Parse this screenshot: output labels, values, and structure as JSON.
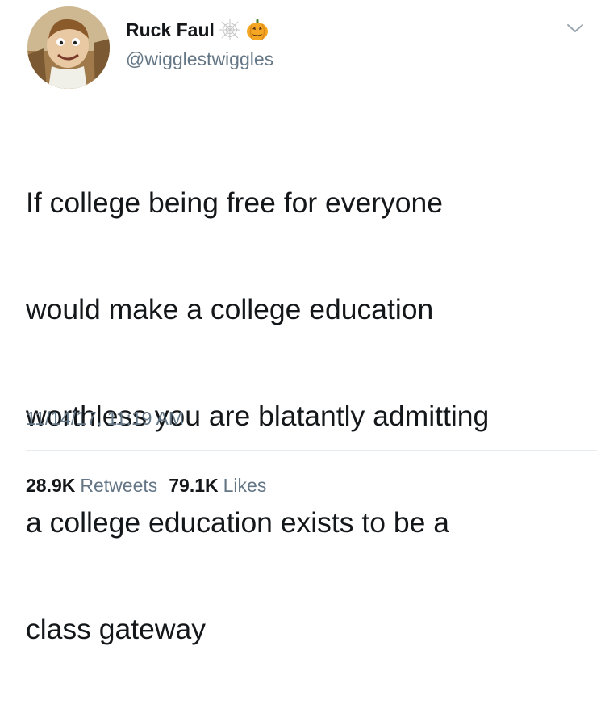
{
  "tweet": {
    "display_name": "Ruck Faul",
    "handle": "@wigglestwiggles",
    "name_emojis": [
      "spiderweb-icon",
      "jack-o-lantern-icon"
    ],
    "text_lines": [
      "If college being free for everyone",
      "would make a college education",
      "worthless you are blatantly admitting",
      "a college education exists to be a",
      "class gateway"
    ],
    "timestamp": "11/14/17, 11:19 AM",
    "retweets_count": "28.9K",
    "retweets_label": "Retweets",
    "likes_count": "79.1K",
    "likes_label": "Likes"
  },
  "colors": {
    "text_primary": "#14171a",
    "text_secondary": "#657786",
    "divider": "#e6ecf0",
    "pumpkin": "#f5a623"
  }
}
